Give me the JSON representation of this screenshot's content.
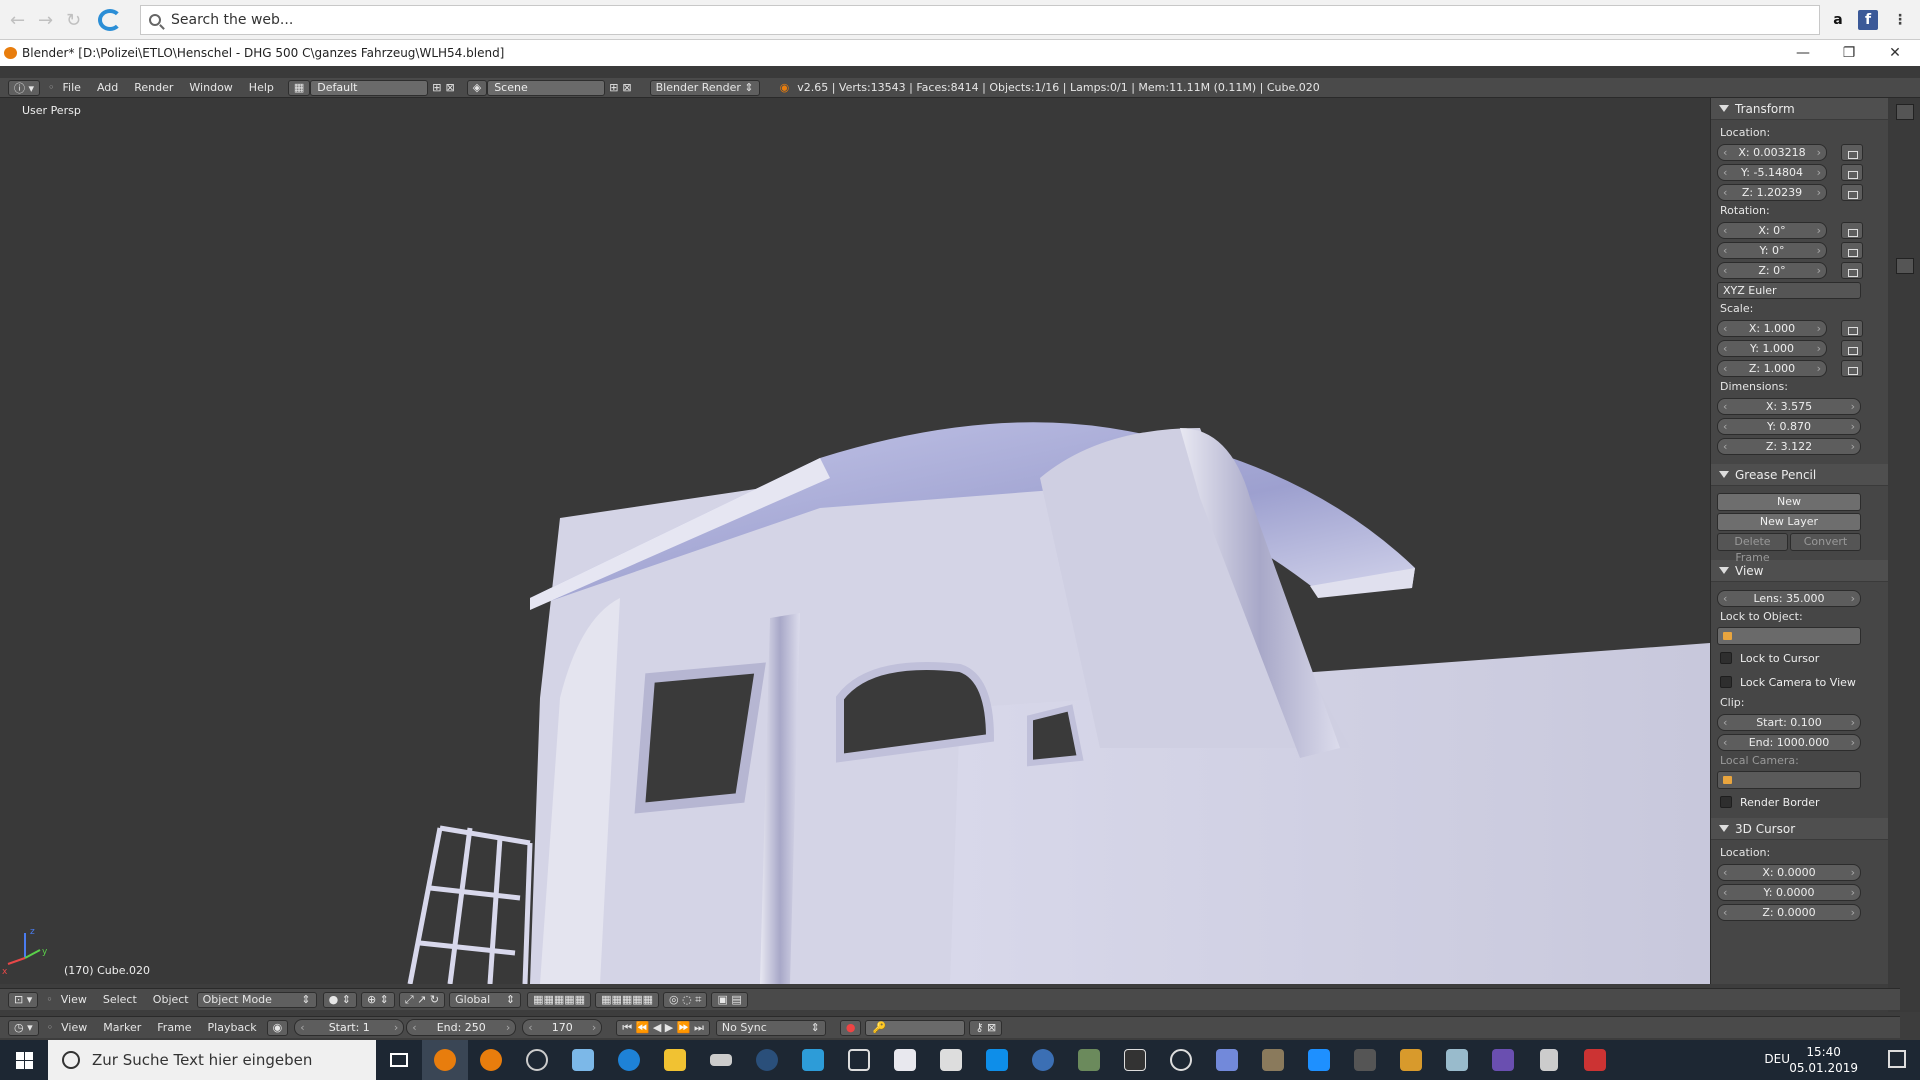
{
  "browser": {
    "search_placeholder": "Search the web..."
  },
  "window": {
    "title": "Blender* [D:\\Polizei\\ETLO\\Henschel - DHG 500 C\\ganzes Fahrzeug\\WLH54.blend]"
  },
  "info_header": {
    "menus": [
      "File",
      "Add",
      "Render",
      "Window",
      "Help"
    ],
    "layout": "Default",
    "scene": "Scene",
    "engine": "Blender Render",
    "stats": "v2.65 | Verts:13543 | Faces:8414 | Objects:1/16 | Lamps:0/1 | Mem:11.11M (0.11M) | Cube.020"
  },
  "viewport": {
    "view_label": "User Persp",
    "object_label": "(170) Cube.020",
    "axis_labels": {
      "z": "z",
      "y": "y",
      "x": "x"
    }
  },
  "npanel": {
    "transform": {
      "title": "Transform",
      "location_label": "Location:",
      "location": [
        "X: 0.003218",
        "Y: -5.14804",
        "Z: 1.20239"
      ],
      "rotation_label": "Rotation:",
      "rotation": [
        "X: 0°",
        "Y: 0°",
        "Z: 0°"
      ],
      "rotation_mode": "XYZ Euler",
      "scale_label": "Scale:",
      "scale": [
        "X: 1.000",
        "Y: 1.000",
        "Z: 1.000"
      ],
      "dimensions_label": "Dimensions:",
      "dimensions": [
        "X: 3.575",
        "Y: 0.870",
        "Z: 3.122"
      ]
    },
    "grease_pencil": {
      "title": "Grease Pencil",
      "new": "New",
      "new_layer": "New Layer",
      "delete_frame": "Delete Frame",
      "convert": "Convert"
    },
    "view": {
      "title": "View",
      "lens": "Lens: 35.000",
      "lock_to_object": "Lock to Object:",
      "lock_to_cursor": "Lock to Cursor",
      "lock_camera": "Lock Camera to View",
      "clip_label": "Clip:",
      "clip_start": "Start: 0.100",
      "clip_end": "End: 1000.000",
      "local_camera": "Local Camera:",
      "render_border": "Render Border"
    },
    "cursor": {
      "title": "3D Cursor",
      "location_label": "Location:",
      "location": [
        "X: 0.0000",
        "Y: 0.0000",
        "Z: 0.0000"
      ]
    }
  },
  "view3d_header": {
    "menus": [
      "View",
      "Select",
      "Object"
    ],
    "mode": "Object Mode",
    "orientation": "Global"
  },
  "timeline_header": {
    "menus": [
      "View",
      "Marker",
      "Frame",
      "Playback"
    ],
    "start": "Start: 1",
    "end": "End: 250",
    "current": "170",
    "sync": "No Sync"
  },
  "taskbar": {
    "search_placeholder": "Zur Suche Text hier eingeben",
    "language": "DEU",
    "time": "15:40",
    "date": "05.01.2019"
  }
}
